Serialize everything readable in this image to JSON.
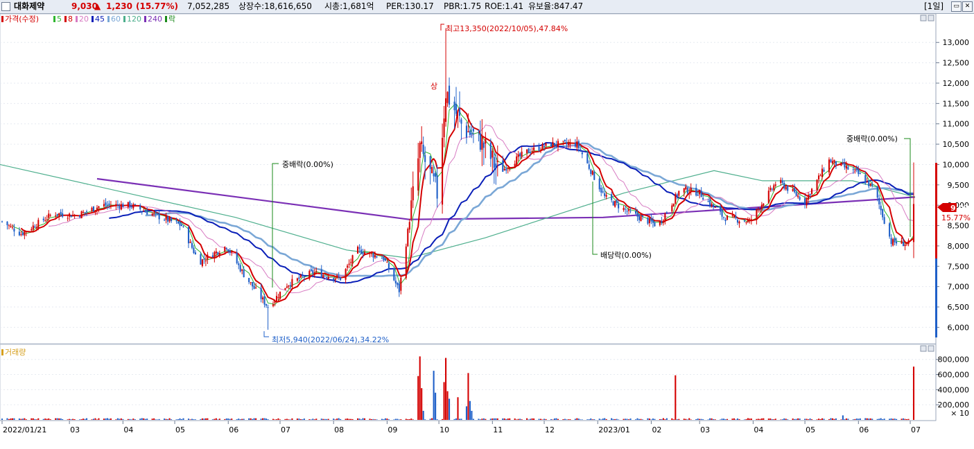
{
  "header": {
    "stock_name": "대화제약",
    "price": "9,030",
    "change_arrow": "▲",
    "change": "1,230",
    "change_pct": "(15.77%)",
    "volume": "7,052,285",
    "listed_shares": "상장수:18,616,650",
    "market_cap": "시총:1,681억",
    "per": "PER:130.17",
    "pbr": "PBR:1.75",
    "roe": "ROE:1.41",
    "float_ratio": "유보율:847.47",
    "period": "[1일]",
    "colors": {
      "up": "#d40000",
      "down": "#1e5fc8",
      "text": "#000000"
    }
  },
  "price_legend": [
    {
      "label": "가격(수정)",
      "color": "#d40000"
    },
    {
      "label": "5",
      "color": "#2fb52f"
    },
    {
      "label": "8",
      "color": "#d40000"
    },
    {
      "label": "20",
      "color": "#d77ac2"
    },
    {
      "label": "45",
      "color": "#0a1fb8"
    },
    {
      "label": "60",
      "color": "#7aa7d6"
    },
    {
      "label": "120",
      "color": "#4cae8c"
    },
    {
      "label": "240",
      "color": "#7a2fb5"
    },
    {
      "label": "락",
      "color": "#1a8a1a"
    }
  ],
  "volume_legend": {
    "label": "거래량",
    "color": "#d6a020"
  },
  "annotations": {
    "high": "최고13,350(2022/10/05),47.84%",
    "low": "최저5,940(2022/06/24),34.22%",
    "div1": "중배락(0.00%)",
    "div2": "배당락(0.00%)",
    "div3": "중배락(0.00%)",
    "up_mark": "상"
  },
  "price_tag": {
    "value": "9,030",
    "pct": "15.77%"
  },
  "chart_data": {
    "type": "candlestick",
    "x_labels": [
      "2022/01/21",
      "03",
      "04",
      "05",
      "06",
      "07",
      "08",
      "09",
      "10",
      "11",
      "12",
      "2023/01",
      "02",
      "03",
      "04",
      "05",
      "06",
      "07"
    ],
    "price_axis_ticks": [
      "13,000",
      "12,500",
      "12,000",
      "11,500",
      "11,000",
      "10,500",
      "10,000",
      "9,500",
      "9,000",
      "8,500",
      "8,000",
      "7,500",
      "7,000",
      "6,500",
      "6,000"
    ],
    "price_range": [
      5700,
      13600
    ],
    "volume_axis_ticks": [
      "800,000",
      "600,000",
      "400,000",
      "200,000"
    ],
    "volume_unit": "× 10",
    "volume_range": [
      0,
      880000
    ],
    "price_anchors": [
      [
        "2022-01-21",
        8600
      ],
      [
        "2022-02-01",
        8300
      ],
      [
        "2022-02-20",
        8800
      ],
      [
        "2022-03-05",
        8750
      ],
      [
        "2022-03-20",
        9000
      ],
      [
        "2022-04-05",
        9000
      ],
      [
        "2022-04-20",
        8750
      ],
      [
        "2022-05-05",
        8500
      ],
      [
        "2022-05-15",
        7600
      ],
      [
        "2022-05-31",
        8000
      ],
      [
        "2022-06-10",
        7300
      ],
      [
        "2022-06-24",
        6500
      ],
      [
        "2022-07-05",
        7050
      ],
      [
        "2022-07-20",
        7350
      ],
      [
        "2022-08-05",
        7200
      ],
      [
        "2022-08-15",
        7900
      ],
      [
        "2022-08-30",
        7700
      ],
      [
        "2022-09-08",
        6900
      ],
      [
        "2022-09-20",
        10400
      ],
      [
        "2022-09-30",
        9300
      ],
      [
        "2022-10-05",
        11800
      ],
      [
        "2022-10-15",
        10900
      ],
      [
        "2022-10-25",
        10600
      ],
      [
        "2022-11-05",
        9800
      ],
      [
        "2022-11-20",
        10300
      ],
      [
        "2022-12-05",
        10500
      ],
      [
        "2022-12-20",
        10500
      ],
      [
        "2023-01-05",
        9200
      ],
      [
        "2023-01-20",
        8800
      ],
      [
        "2023-02-05",
        8500
      ],
      [
        "2023-02-18",
        9400
      ],
      [
        "2023-03-01",
        9300
      ],
      [
        "2023-03-15",
        8700
      ],
      [
        "2023-03-30",
        8600
      ],
      [
        "2023-04-15",
        9600
      ],
      [
        "2023-05-01",
        9100
      ],
      [
        "2023-05-15",
        10100
      ],
      [
        "2023-05-31",
        9800
      ],
      [
        "2023-06-10",
        9400
      ],
      [
        "2023-06-20",
        8100
      ],
      [
        "2023-06-30",
        8050
      ],
      [
        "2023-07-03",
        9030
      ]
    ],
    "volume_spikes": [
      [
        "2022-09-19",
        580000
      ],
      [
        "2022-09-20",
        840000
      ],
      [
        "2022-09-21",
        420000
      ],
      [
        "2022-09-22",
        120000
      ],
      [
        "2022-09-28",
        650000
      ],
      [
        "2022-09-29",
        360000
      ],
      [
        "2022-10-04",
        500000
      ],
      [
        "2022-10-05",
        820000
      ],
      [
        "2022-10-06",
        380000
      ],
      [
        "2022-10-07",
        280000
      ],
      [
        "2022-10-12",
        300000
      ],
      [
        "2022-10-17",
        180000
      ],
      [
        "2022-10-18",
        620000
      ],
      [
        "2022-10-19",
        250000
      ],
      [
        "2022-10-20",
        120000
      ],
      [
        "2023-02-15",
        590000
      ],
      [
        "2023-05-23",
        60000
      ],
      [
        "2023-07-03",
        705000
      ]
    ],
    "moving_averages": [
      {
        "name": "240",
        "values": [
          [
            140,
            9650
          ],
          [
            590,
            8650
          ],
          [
            870,
            8700
          ],
          [
            1320,
            9200
          ]
        ]
      },
      {
        "name": "120",
        "values": [
          [
            0,
            10000
          ],
          [
            340,
            8700
          ],
          [
            500,
            7900
          ],
          [
            590,
            7700
          ],
          [
            700,
            8200
          ],
          [
            900,
            9300
          ],
          [
            1030,
            9850
          ],
          [
            1100,
            9600
          ],
          [
            1230,
            9600
          ],
          [
            1320,
            9200
          ]
        ]
      }
    ],
    "ylim": [
      5700,
      13600
    ]
  }
}
